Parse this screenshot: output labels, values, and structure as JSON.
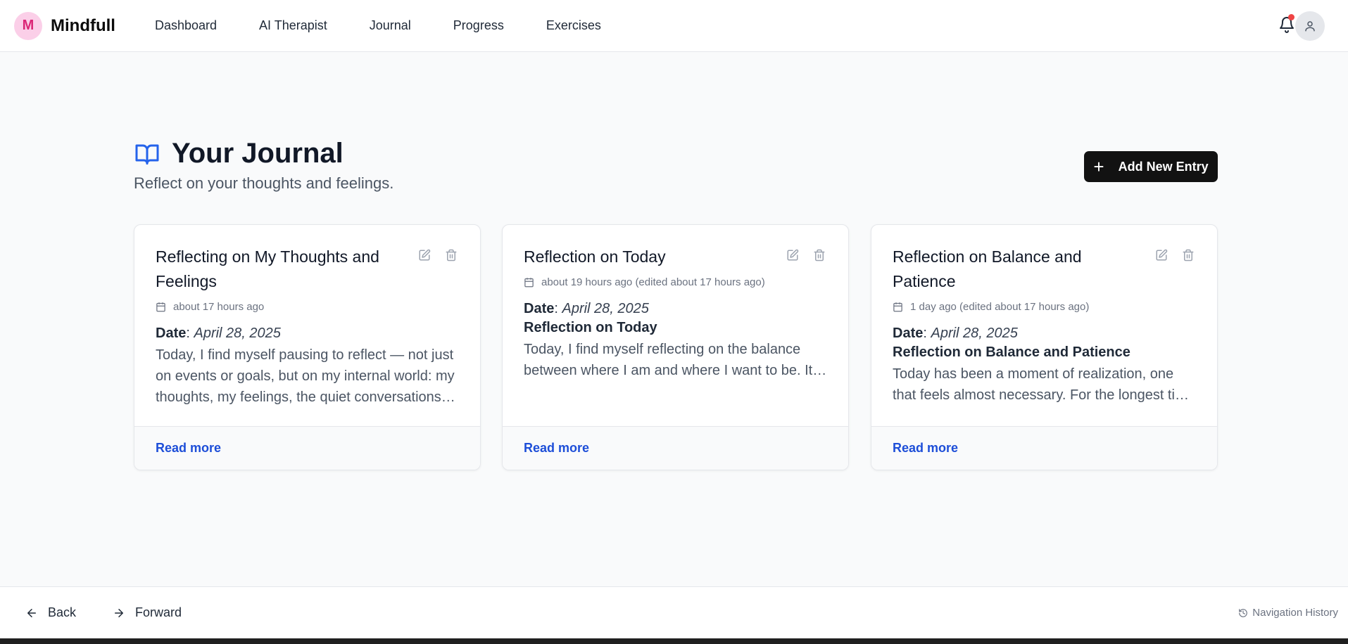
{
  "brand": {
    "initial": "M",
    "name": "Mindfull"
  },
  "nav": {
    "items": [
      {
        "label": "Dashboard"
      },
      {
        "label": "AI Therapist"
      },
      {
        "label": "Journal"
      },
      {
        "label": "Progress"
      },
      {
        "label": "Exercises"
      }
    ]
  },
  "header_icons": {
    "notifications": "bell-icon",
    "profile": "user-icon",
    "notification_dot_color": "#ef4444"
  },
  "page": {
    "title": "Your Journal",
    "subtitle": "Reflect on your thoughts and feelings.",
    "add_button": "Add New Entry"
  },
  "entries": [
    {
      "title": "Reflecting on My Thoughts and Feelings",
      "meta": "about 17 hours ago",
      "date_label": "Date",
      "date_value": "April 28, 2025",
      "heading": "",
      "excerpt": "Today, I find myself pausing to reflect — not just on events or goals, but on my internal world: my thoughts, my feelings, the quiet conversations I have with myself every day.",
      "read_more": "Read more"
    },
    {
      "title": "Reflection on Today",
      "meta": "about 19 hours ago (edited about 17 hours ago)",
      "date_label": "Date",
      "date_value": "April 28, 2025",
      "heading": "Reflection on Today",
      "excerpt": "Today, I find myself reflecting on the balance between where I am and where I want to be. It’s a quiet moment of honesty.",
      "read_more": "Read more"
    },
    {
      "title": "Reflection on Balance and Patience",
      "meta": "1 day ago (edited about 17 hours ago)",
      "date_label": "Date",
      "date_value": "April 28, 2025",
      "heading": "Reflection on Balance and Patience",
      "excerpt": "Today has been a moment of realization, one that feels almost necessary. For the longest time I have been rushing.",
      "read_more": "Read more"
    }
  ],
  "footer": {
    "back": "Back",
    "forward": "Forward",
    "history": "Navigation History"
  },
  "colors": {
    "accent_blue": "#1d4ed8",
    "brand_pink": "#db2777",
    "button_dark": "#121212"
  }
}
